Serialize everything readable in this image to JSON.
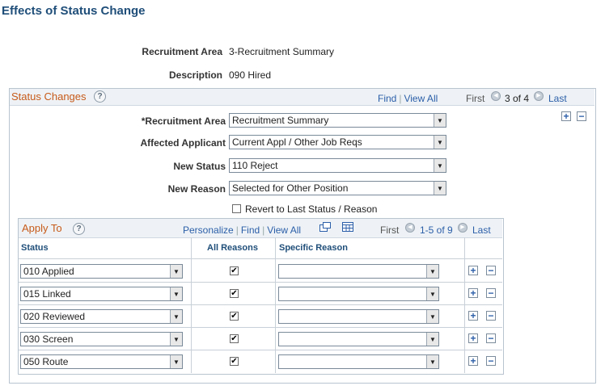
{
  "page": {
    "title": "Effects of Status Change"
  },
  "header_fields": {
    "recruitment_area_label": "Recruitment Area",
    "recruitment_area_value": "3-Recruitment Summary",
    "description_label": "Description",
    "description_value": "090 Hired"
  },
  "status_changes": {
    "title": "Status Changes",
    "help_glyph": "?",
    "find": "Find",
    "view_all": "View All",
    "first": "First",
    "position": "3 of 4",
    "last": "Last",
    "recruitment_area_label": "*Recruitment Area",
    "recruitment_area_value": "Recruitment Summary",
    "affected_applicant_label": "Affected Applicant",
    "affected_applicant_value": "Current Appl / Other Job Reqs",
    "new_status_label": "New Status",
    "new_status_value": "110 Reject",
    "new_reason_label": "New Reason",
    "new_reason_value": "Selected for Other Position",
    "revert_label": "Revert to Last Status / Reason",
    "revert_checked": false
  },
  "apply_to": {
    "title": "Apply To",
    "help_glyph": "?",
    "personalize": "Personalize",
    "find": "Find",
    "view_all": "View All",
    "first": "First",
    "range": "1-5 of 9",
    "last": "Last",
    "columns": {
      "status": "Status",
      "all_reasons": "All Reasons",
      "specific_reason": "Specific Reason"
    },
    "rows": [
      {
        "status": "010 Applied",
        "all_reasons": true,
        "specific_reason": ""
      },
      {
        "status": "015 Linked",
        "all_reasons": true,
        "specific_reason": ""
      },
      {
        "status": "020 Reviewed",
        "all_reasons": true,
        "specific_reason": ""
      },
      {
        "status": "030 Screen",
        "all_reasons": true,
        "specific_reason": ""
      },
      {
        "status": "050 Route",
        "all_reasons": true,
        "specific_reason": ""
      }
    ]
  },
  "icons": {
    "add": "+",
    "delete": "−",
    "dropdown": "▼",
    "check": "✔",
    "prev": "◀",
    "next": "▶"
  },
  "colors": {
    "title": "#1f4e79",
    "section_header": "#c75a1a",
    "link": "#2b5ea8"
  }
}
